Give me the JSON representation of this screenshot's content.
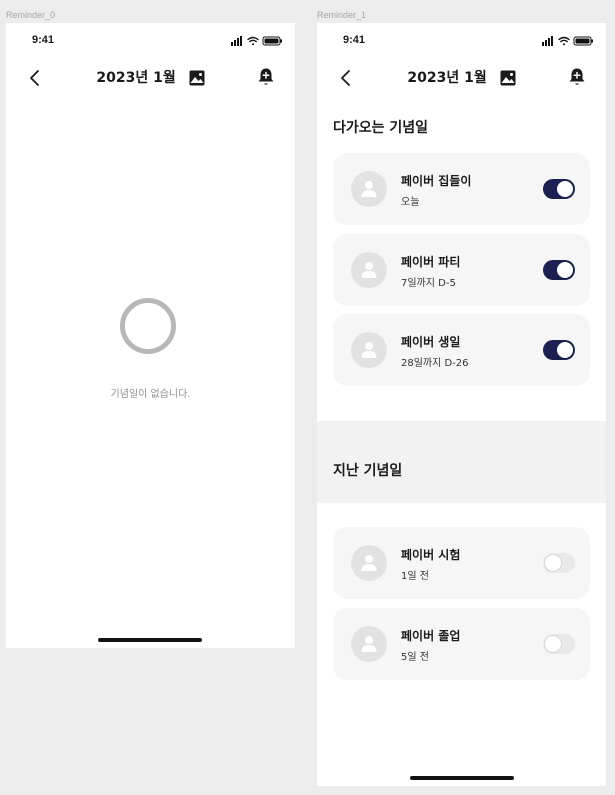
{
  "frames": [
    {
      "label": "Reminder_0",
      "status": {
        "time": "9:41"
      },
      "header": {
        "title": "2023년 1월"
      },
      "empty_text": "기념일이 없습니다."
    },
    {
      "label": "Reminder_1",
      "status": {
        "time": "9:41"
      },
      "header": {
        "title": "2023년 1월"
      },
      "upcoming": {
        "title": "다가오는 기념일",
        "items": [
          {
            "name": "페이버 집들이",
            "sub": "오늘",
            "toggle": "on"
          },
          {
            "name": "페이버 파티",
            "sub": "7일까지 D-5",
            "toggle": "on"
          },
          {
            "name": "페이버 생일",
            "sub": "28일까지 D-26",
            "toggle": "on"
          }
        ]
      },
      "past": {
        "title": "지난 기념일",
        "items": [
          {
            "name": "페이버 시험",
            "sub": "1일 전",
            "toggle": "off"
          },
          {
            "name": "페이버 졸업",
            "sub": "5일 전",
            "toggle": "off"
          }
        ]
      }
    }
  ],
  "icons": {
    "back": "chevron-left-icon",
    "image": "image-icon",
    "bell": "bell-plus-icon",
    "avatar": "person-icon",
    "signal": "signal-icon",
    "wifi": "wifi-icon",
    "battery": "battery-icon"
  },
  "colors": {
    "toggle_on": "#1a2150",
    "toggle_off": "#e9e9e9",
    "card_bg": "#f6f6f6",
    "avatar_bg": "#e2e2e2",
    "loading_ring": "#b7b7b7"
  }
}
